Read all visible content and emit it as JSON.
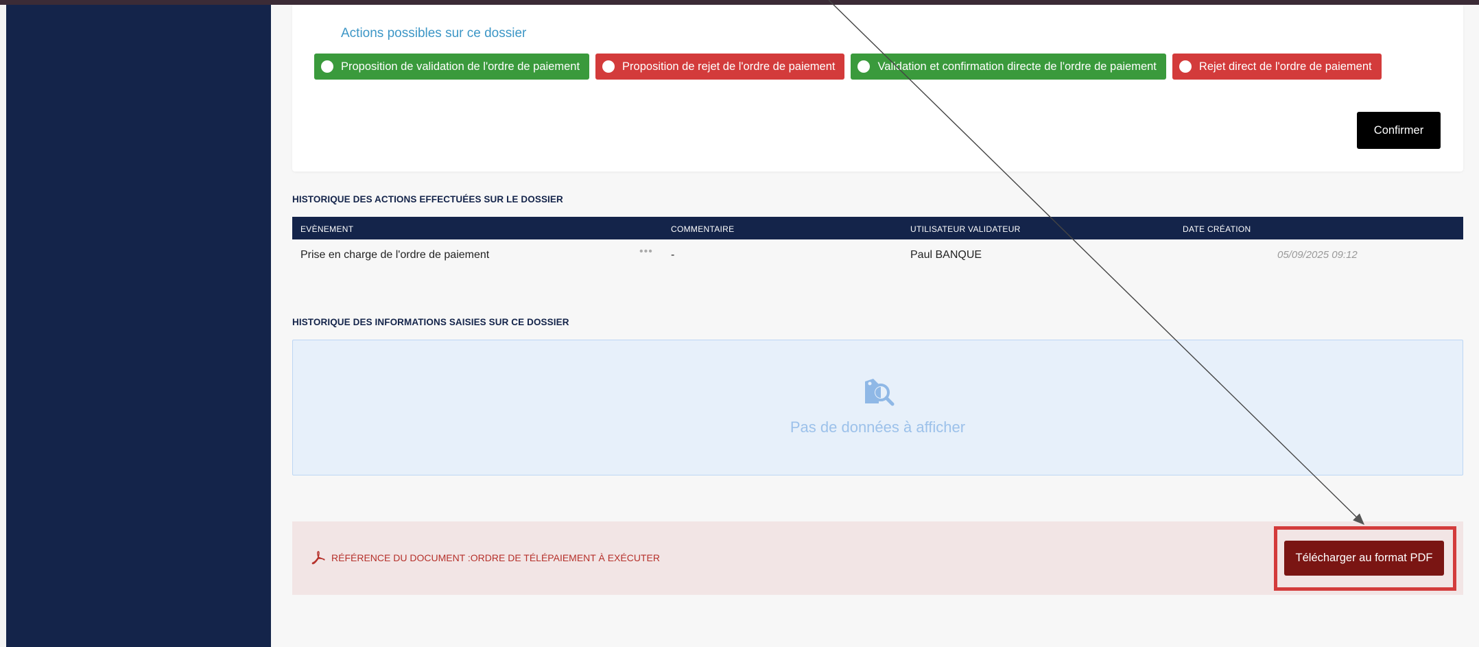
{
  "card": {
    "title": "Actions possibles sur ce dossier",
    "actions": [
      {
        "label": "Proposition de validation de l'ordre de paiement",
        "color": "#3a9a3c"
      },
      {
        "label": "Proposition de rejet de l'ordre de paiement",
        "color": "#d33b3b"
      },
      {
        "label": "Validation et confirmation directe de l'ordre de paiement",
        "color": "#3a9a3c"
      },
      {
        "label": "Rejet direct de l'ordre de paiement",
        "color": "#d33b3b"
      }
    ],
    "confirm_label": "Confirmer"
  },
  "history_actions": {
    "title": "HISTORIQUE DES ACTIONS EFFECTUÉES SUR LE DOSSIER",
    "columns": [
      "EVÈNEMENT",
      "COMMENTAIRE",
      "UTILISATEUR VALIDATEUR",
      "DATE CRÉATION"
    ],
    "rows": [
      {
        "event": "Prise en charge de l'ordre de paiement",
        "more": "•••",
        "comment": "-",
        "user": "Paul BANQUE",
        "date": "05/09/2025 09:12"
      }
    ]
  },
  "history_info": {
    "title": "HISTORIQUE DES INFORMATIONS SAISIES SUR CE DOSSIER",
    "empty_text": "Pas de données à afficher",
    "empty_icon": "search-tag-icon"
  },
  "document": {
    "reference_label": "RÉFÉRENCE DU DOCUMENT :ORDRE DE TÉLÉPAIEMENT À EXÉCUTER",
    "icon": "pdf-icon",
    "download_label": "Télécharger au format PDF"
  },
  "colors": {
    "sidebar": "#14244a",
    "accent_title": "#3c96c6",
    "pdf_button": "#7a1513",
    "highlight": "#d33b3b"
  }
}
